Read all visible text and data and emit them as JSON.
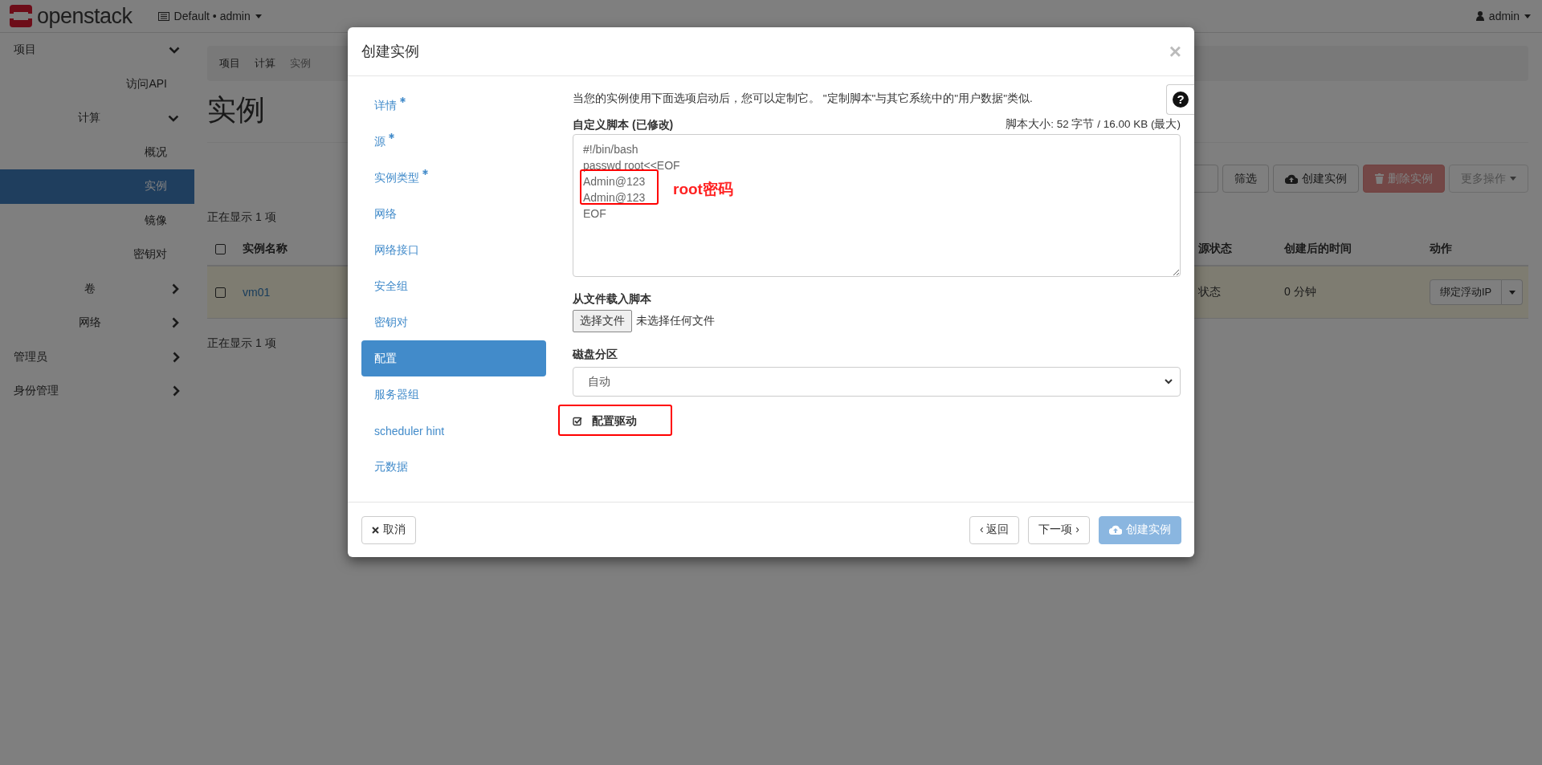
{
  "header": {
    "logo": "openstack",
    "project": "Default • admin",
    "user": "admin"
  },
  "sidebar": {
    "items": [
      {
        "label": "项目",
        "expanded": true,
        "children": [
          {
            "label": "访问API",
            "selected": false
          },
          {
            "label": "计算",
            "expanded": true,
            "children": [
              {
                "label": "概况",
                "selected": false
              },
              {
                "label": "实例",
                "selected": true
              },
              {
                "label": "镜像",
                "selected": false
              },
              {
                "label": "密钥对",
                "selected": false
              }
            ]
          },
          {
            "label": "卷",
            "expanded": false
          },
          {
            "label": "网络",
            "expanded": false
          }
        ]
      },
      {
        "label": "管理员",
        "expanded": false
      },
      {
        "label": "身份管理",
        "expanded": false
      }
    ]
  },
  "breadcrumb": [
    "项目",
    "计算",
    "实例"
  ],
  "page_title": "实例",
  "toolbar": {
    "buttons": [
      {
        "label": "筛选",
        "kind": "plain"
      },
      {
        "label": "创建实例",
        "kind": "create"
      },
      {
        "label": "删除实例",
        "kind": "danger"
      },
      {
        "label": "更多操作",
        "kind": "menu"
      }
    ]
  },
  "table": {
    "count_top": "正在显示 1 项",
    "header_checked": false,
    "columns": [
      "实例名称",
      "源状态",
      "创建后的时间",
      "动作"
    ],
    "rows": [
      {
        "checked": false,
        "cells": [
          "vm01",
          "状态",
          "0 分钟"
        ],
        "action": "绑定浮动IP"
      }
    ],
    "count_bottom": "正在显示 1 项"
  },
  "modal": {
    "title": "创建实例",
    "close": "×",
    "help": "?",
    "steps": [
      {
        "label": "详情",
        "required": true,
        "selected": false
      },
      {
        "label": "源",
        "required": true,
        "selected": false
      },
      {
        "label": "实例类型",
        "required": true,
        "selected": false
      },
      {
        "label": "网络",
        "required": false,
        "selected": false
      },
      {
        "label": "网络接口",
        "required": false,
        "selected": false
      },
      {
        "label": "安全组",
        "required": false,
        "selected": false
      },
      {
        "label": "密钥对",
        "required": false,
        "selected": false
      },
      {
        "label": "配置",
        "required": false,
        "selected": true
      },
      {
        "label": "服务器组",
        "required": false,
        "selected": false
      },
      {
        "label": "scheduler hint",
        "required": false,
        "selected": false
      },
      {
        "label": "元数据",
        "required": false,
        "selected": false
      }
    ],
    "description": "当您的实例使用下面选项启动后，您可以定制它。 \"定制脚本\"与其它系统中的\"用户数据\"类似.",
    "script_label": "自定义脚本 (已修改)",
    "script_size": "脚本大小: 52 字节 / 16.00 KB (最大)",
    "script": "#!/bin/bash\npasswd root<<EOF\nAdmin@123\nAdmin@123\nEOF",
    "annotation": "root密码",
    "file_label": "从文件载入脚本",
    "file_button": "选择文件",
    "file_status": "未选择任何文件",
    "disk_label": "磁盘分区",
    "disk_value": "自动",
    "config_drive": {
      "label": "配置驱动",
      "checked": true
    },
    "footer": {
      "cancel": "取消",
      "back": "‹ 返回",
      "next": "下一项 ›",
      "create": {
        "label": "创建实例",
        "disabled": true
      }
    }
  }
}
